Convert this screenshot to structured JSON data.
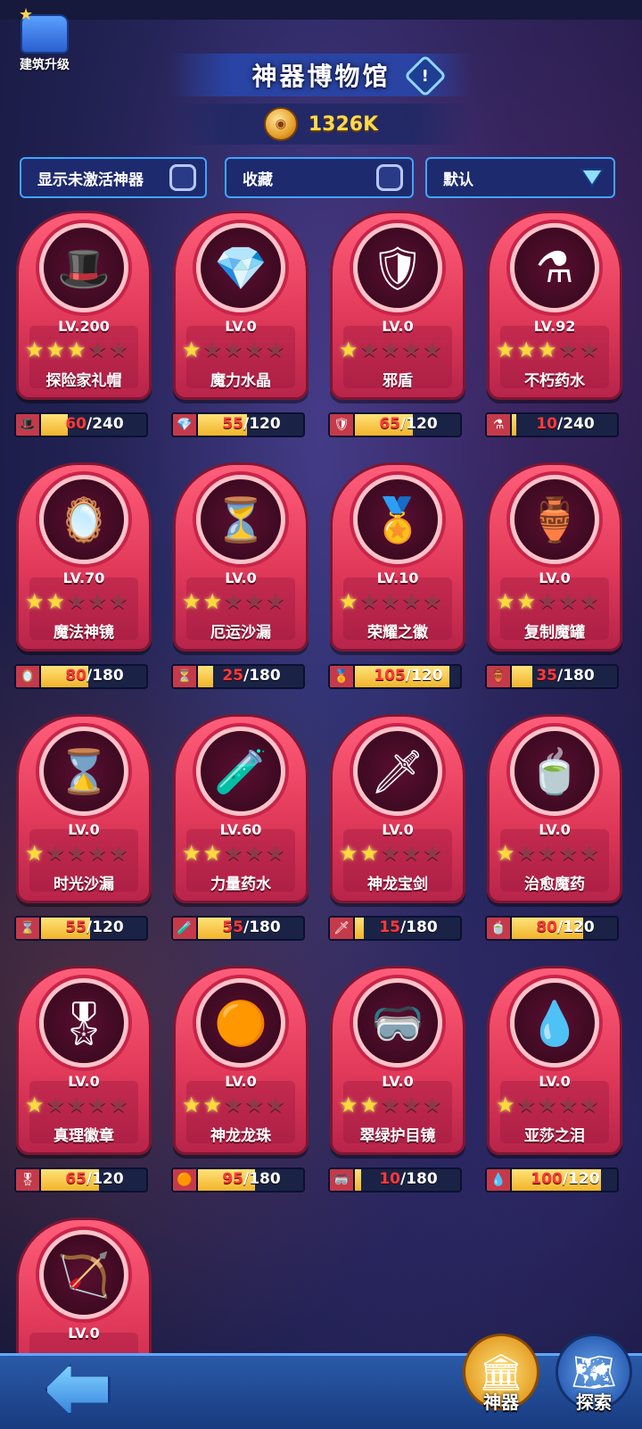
{
  "header": {
    "build_label": "建筑升级",
    "title": "神器博物馆",
    "info_symbol": "!",
    "coins": "1326K"
  },
  "filters": {
    "show_inactive": "显示未激活神器",
    "favorites": "收藏",
    "sort": "默认"
  },
  "artifacts": [
    {
      "name": "探险家礼帽",
      "level": "LV.200",
      "stars": 3,
      "current": "60",
      "max": "/240",
      "progress": 0.25,
      "icon": "🎩"
    },
    {
      "name": "魔力水晶",
      "level": "LV.0",
      "stars": 1,
      "current": "55",
      "max": "/120",
      "progress": 0.46,
      "icon": "💎"
    },
    {
      "name": "邪盾",
      "level": "LV.0",
      "stars": 1,
      "current": "65",
      "max": "/120",
      "progress": 0.54,
      "icon": "🛡"
    },
    {
      "name": "不朽药水",
      "level": "LV.92",
      "stars": 3,
      "current": "10",
      "max": "/240",
      "progress": 0.04,
      "icon": "⚗"
    },
    {
      "name": "魔法神镜",
      "level": "LV.70",
      "stars": 2,
      "current": "80",
      "max": "/180",
      "progress": 0.44,
      "icon": "🪞"
    },
    {
      "name": "厄运沙漏",
      "level": "LV.0",
      "stars": 2,
      "current": "25",
      "max": "/180",
      "progress": 0.14,
      "icon": "⏳"
    },
    {
      "name": "荣耀之徽",
      "level": "LV.10",
      "stars": 1,
      "current": "105",
      "max": "/120",
      "progress": 0.88,
      "icon": "🏅"
    },
    {
      "name": "复制魔罐",
      "level": "LV.0",
      "stars": 2,
      "current": "35",
      "max": "/180",
      "progress": 0.19,
      "icon": "🏺"
    },
    {
      "name": "时光沙漏",
      "level": "LV.0",
      "stars": 1,
      "current": "55",
      "max": "/120",
      "progress": 0.46,
      "icon": "⌛"
    },
    {
      "name": "力量药水",
      "level": "LV.60",
      "stars": 2,
      "current": "55",
      "max": "/180",
      "progress": 0.31,
      "icon": "🧪"
    },
    {
      "name": "神龙宝剑",
      "level": "LV.0",
      "stars": 2,
      "current": "15",
      "max": "/180",
      "progress": 0.08,
      "icon": "🗡"
    },
    {
      "name": "治愈魔药",
      "level": "LV.0",
      "stars": 1,
      "current": "80",
      "max": "/120",
      "progress": 0.67,
      "icon": "🍵"
    },
    {
      "name": "真理徽章",
      "level": "LV.0",
      "stars": 1,
      "current": "65",
      "max": "/120",
      "progress": 0.54,
      "icon": "🎖"
    },
    {
      "name": "神龙龙珠",
      "level": "LV.0",
      "stars": 2,
      "current": "95",
      "max": "/180",
      "progress": 0.53,
      "icon": "🟠"
    },
    {
      "name": "翠绿护目镜",
      "level": "LV.0",
      "stars": 2,
      "current": "10",
      "max": "/180",
      "progress": 0.06,
      "icon": "🥽"
    },
    {
      "name": "亚莎之泪",
      "level": "LV.0",
      "stars": 1,
      "current": "100",
      "max": "/120",
      "progress": 0.83,
      "icon": "💧"
    },
    {
      "name": "",
      "level": "LV.0",
      "stars": 0,
      "current": "",
      "max": "",
      "progress": 0,
      "icon": "🏹"
    }
  ],
  "bottom": {
    "artifact_label": "神器",
    "explore_label": "探索"
  }
}
